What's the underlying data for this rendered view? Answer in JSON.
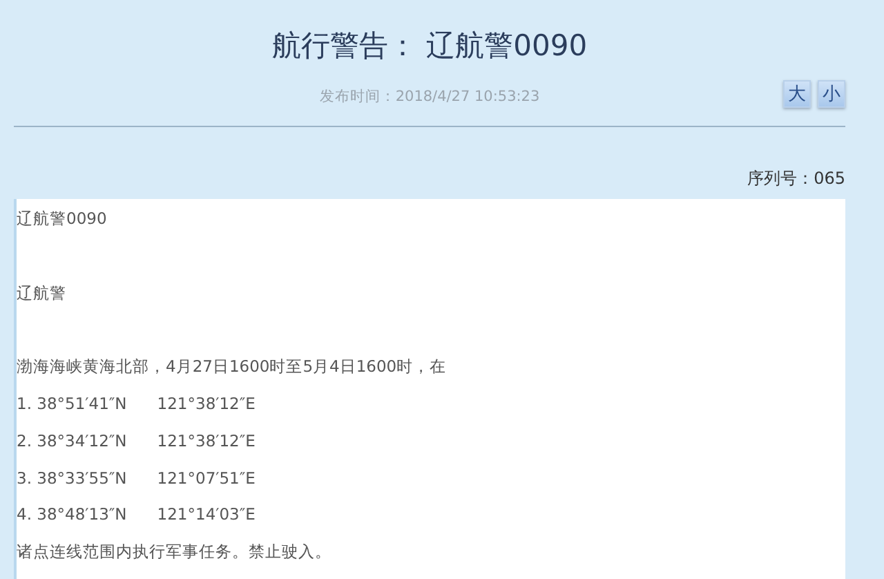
{
  "header": {
    "title": "航行警告： 辽航警0090",
    "published": "发布时间：2018/4/27 10:53:23",
    "font_buttons": [
      "大",
      "小"
    ]
  },
  "serial": "序列号：065",
  "notice": {
    "lines": [
      {
        "kind": "text",
        "text": "辽航警0090"
      },
      {
        "kind": "gap"
      },
      {
        "kind": "text",
        "text": "辽航警"
      },
      {
        "kind": "gap"
      },
      {
        "kind": "text",
        "text": "渤海海峡黄海北部，4月27日1600时至5月4日1600时，在"
      },
      {
        "kind": "point",
        "number": "1.",
        "lat": "38°51′41″N",
        "lon": "121°38′12″E"
      },
      {
        "kind": "point",
        "number": "2.",
        "lat": "38°34′12″N",
        "lon": "121°38′12″E"
      },
      {
        "kind": "point",
        "number": "3.",
        "lat": "38°33′55″N",
        "lon": "121°07′51″E"
      },
      {
        "kind": "point",
        "number": "4.",
        "lat": "38°48′13″N",
        "lon": "121°14′03″E"
      },
      {
        "kind": "text",
        "text": "诸点连线范围内执行军事任务。禁止驶入。"
      }
    ]
  }
}
